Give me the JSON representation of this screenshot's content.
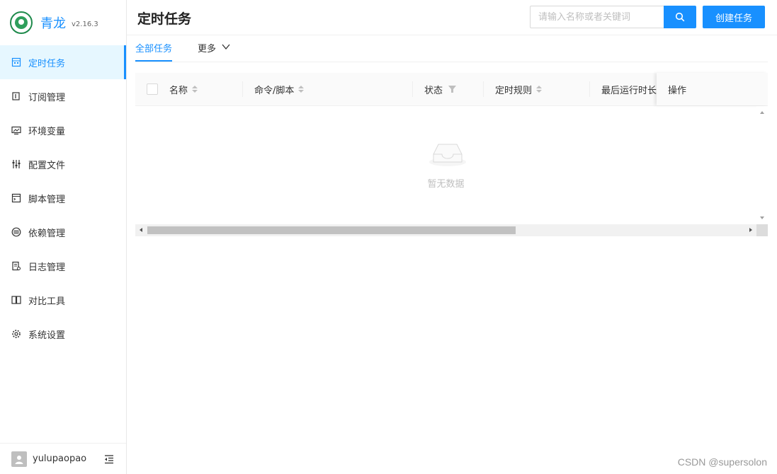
{
  "brand": {
    "name": "青龙",
    "version": "v2.16.3"
  },
  "menu": [
    {
      "label": "定时任务",
      "icon": "calendar-icon",
      "active": true
    },
    {
      "label": "订阅管理",
      "icon": "subscription-icon",
      "active": false
    },
    {
      "label": "环境变量",
      "icon": "monitor-icon",
      "active": false
    },
    {
      "label": "配置文件",
      "icon": "sliders-icon",
      "active": false
    },
    {
      "label": "脚本管理",
      "icon": "terminal-icon",
      "active": false
    },
    {
      "label": "依赖管理",
      "icon": "layers-icon",
      "active": false
    },
    {
      "label": "日志管理",
      "icon": "log-file-icon",
      "active": false
    },
    {
      "label": "对比工具",
      "icon": "diff-icon",
      "active": false
    },
    {
      "label": "系统设置",
      "icon": "gear-icon",
      "active": false
    }
  ],
  "user": {
    "name": "yulupaopao"
  },
  "page": {
    "title": "定时任务"
  },
  "search": {
    "placeholder": "请输入名称或者关键词"
  },
  "actions": {
    "create_label": "创建任务"
  },
  "tabs": {
    "all": "全部任务",
    "more": "更多"
  },
  "table": {
    "columns": {
      "name": "名称",
      "command": "命令/脚本",
      "status": "状态",
      "schedule": "定时规则",
      "last_run": "最后运行时长",
      "ops": "操作"
    },
    "empty_text": "暂无数据"
  },
  "watermark": "CSDN @supersolon",
  "colors": {
    "accent": "#1890ff",
    "active_bg": "#e6f7ff"
  }
}
